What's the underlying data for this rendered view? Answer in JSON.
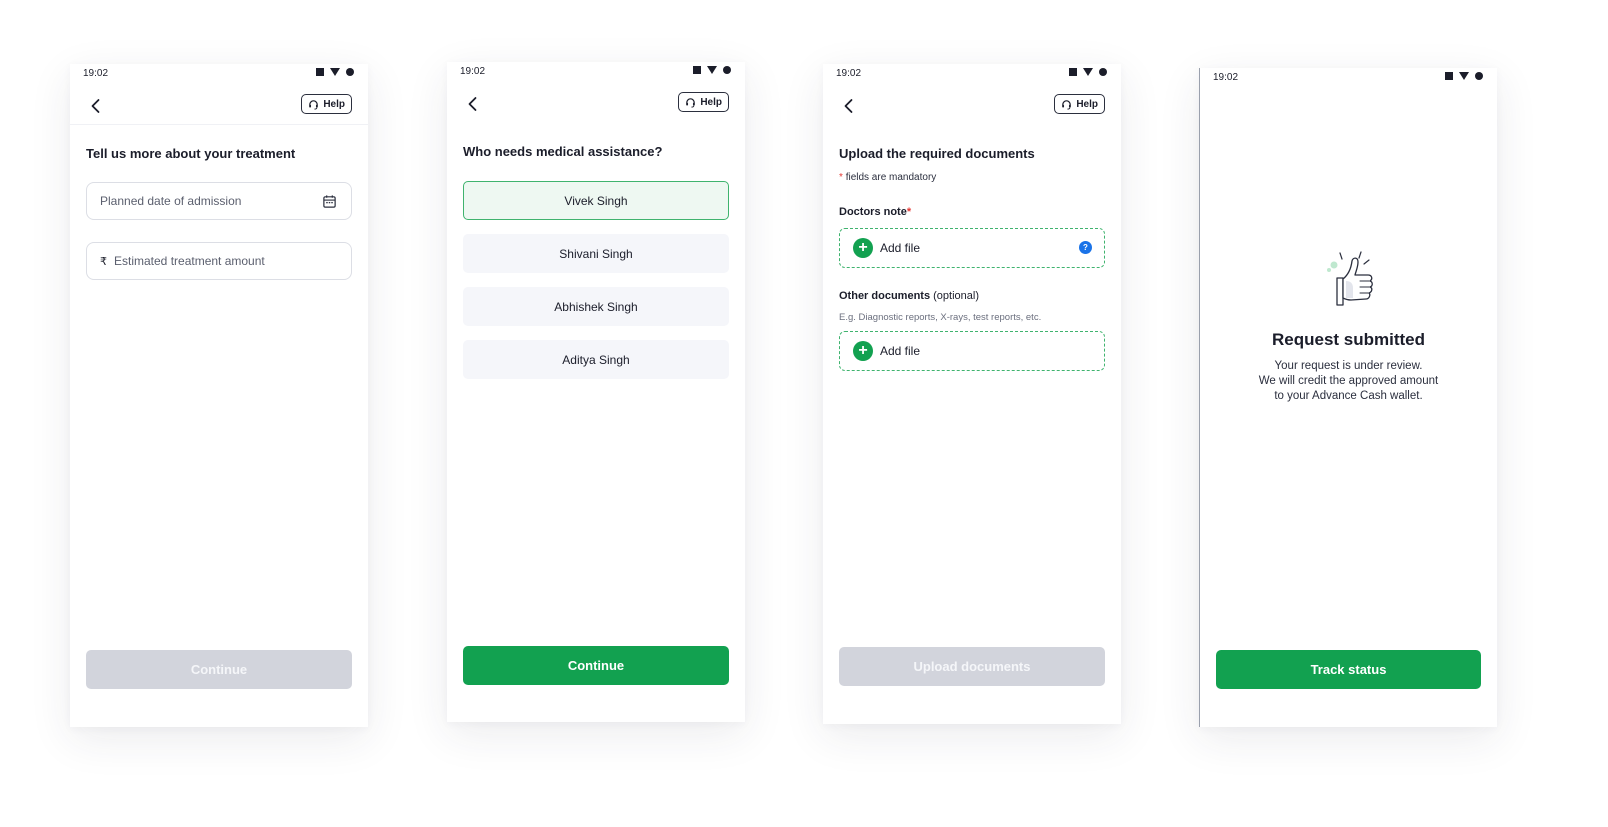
{
  "status_time": "19:02",
  "help_label": "Help",
  "colors": {
    "primary": "#12a150",
    "disabled": "#d2d4dc",
    "selected_bg": "#eef8f2",
    "required": "#e53935",
    "info": "#1a73e8"
  },
  "screen1": {
    "title": "Tell us more about your treatment",
    "date_placeholder": "Planned date of admission",
    "currency_symbol": "₹",
    "amount_placeholder": "Estimated treatment amount",
    "continue_label": "Continue"
  },
  "screen2": {
    "title": "Who needs medical assistance?",
    "options": [
      {
        "label": "Vivek Singh",
        "selected": true
      },
      {
        "label": "Shivani Singh",
        "selected": false
      },
      {
        "label": "Abhishek Singh",
        "selected": false
      },
      {
        "label": "Aditya Singh",
        "selected": false
      }
    ],
    "continue_label": "Continue"
  },
  "screen3": {
    "title": "Upload the required documents",
    "mandatory_star": "*",
    "mandatory_note": "fields are mandatory",
    "doctors_note_label": "Doctors note",
    "required_star": "*",
    "add_file_label": "Add file",
    "help_mark": "?",
    "other_docs_label": "Other documents",
    "other_docs_optional": "(optional)",
    "other_docs_hint": "E.g. Diagnostic reports, X-rays, test reports, etc.",
    "add_file_label_2": "Add file",
    "upload_label": "Upload documents"
  },
  "screen4": {
    "title": "Request submitted",
    "lines": [
      "Your request is under review.",
      "We will credit the approved amount",
      "to your Advance Cash wallet."
    ],
    "track_label": "Track status"
  }
}
